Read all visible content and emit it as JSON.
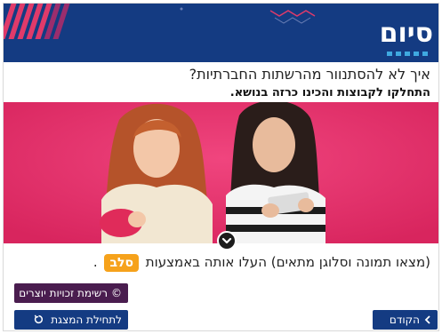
{
  "header": {
    "title": "סיום",
    "colors": {
      "banner": "#143b82",
      "stripe_pink": "#e03a6a",
      "stripe_purple": "#9b2d6d"
    }
  },
  "content": {
    "question": "איך לא להסתנוור מהרשתות החברתיות?",
    "instruction": "התחלקו לקבוצות והכינו כרזה בנושא.",
    "image_icon": "photo-two-girls-using-phones",
    "task_prefix": "(מצאו תמונה וסלוגן מתאים) העלו אותה באמצעות",
    "task_app": "סלב",
    "task_suffix": "."
  },
  "buttons": {
    "credits_label": "רשימת זכויות יוצרים",
    "credits_icon": "©",
    "restart_label": "לתחילת המצגת",
    "restart_icon": "restart-icon",
    "prev_label": "הקודם",
    "prev_icon": "chevron-left-icon"
  }
}
